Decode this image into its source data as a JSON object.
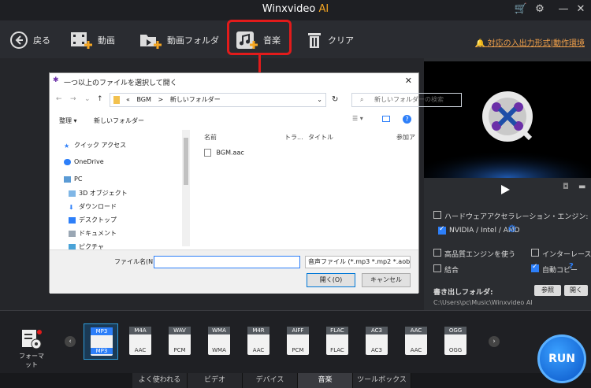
{
  "app": {
    "title_main": "Winxvideo",
    "title_accent": "AI"
  },
  "toolbar": {
    "back": "戻る",
    "video": "動画",
    "video_folder": "動画フォルダ",
    "music": "音楽",
    "clear": "クリア",
    "support_link": "対応の入出力形式|動作環境"
  },
  "dialog": {
    "title": "一つ以上のファイルを選択して開く",
    "breadcrumb": [
      "«",
      "BGM",
      ">",
      "新しいフォルダー"
    ],
    "search_placeholder": "新しいフォルダーの検索",
    "organize": "整理 ▾",
    "new_folder": "新しいフォルダー",
    "nav": [
      "クイック アクセス",
      "OneDrive",
      "PC",
      "3D オブジェクト",
      "ダウンロード",
      "デスクトップ",
      "ドキュメント",
      "ピクチャ"
    ],
    "columns": [
      "名前",
      "トラ...",
      "タイトル",
      "参加ア"
    ],
    "files": [
      "BGM.aac"
    ],
    "filename_label": "ファイル名(N):",
    "filename_value": "",
    "filetype": "音声ファイル (*.mp3 *.mp2 *.aob",
    "open_btn": "開く(O)",
    "cancel_btn": "キャンセル"
  },
  "panel": {
    "hw_accel": "ハードウェアアクセラレーション・エンジン:",
    "gpu": "NVIDIA / Intel / AMD",
    "hq_engine": "高品質エンジンを使う",
    "deinterlace": "インターレース解除",
    "merge": "結合",
    "auto_copy": "自動コピー",
    "output_folder_label": "書き出しフォルダ:",
    "browse": "参照",
    "open": "開く",
    "output_path": "C:\\Users\\pc\\Music\\Winxvideo AI"
  },
  "formats": [
    {
      "tag": "MP3",
      "sub": "MP3",
      "selected": true
    },
    {
      "tag": "M4A",
      "sub": "AAC"
    },
    {
      "tag": "WAV",
      "sub": "PCM"
    },
    {
      "tag": "WMA",
      "sub": "WMA"
    },
    {
      "tag": "M4R",
      "sub": "AAC"
    },
    {
      "tag": "AIFF",
      "sub": "PCM"
    },
    {
      "tag": "FLAC",
      "sub": "FLAC"
    },
    {
      "tag": "AC3",
      "sub": "AC3"
    },
    {
      "tag": "AAC",
      "sub": "AAC"
    },
    {
      "tag": "OGG",
      "sub": "OGG"
    }
  ],
  "format_label": "フォーマット",
  "tabs": [
    "よく使われる",
    "ビデオ",
    "デバイス",
    "音楽",
    "ツールボックス"
  ],
  "run": "RUN",
  "colors": {
    "accent": "#2d7ff9",
    "highlight": "#e21b1b",
    "orange": "#f5a623"
  }
}
